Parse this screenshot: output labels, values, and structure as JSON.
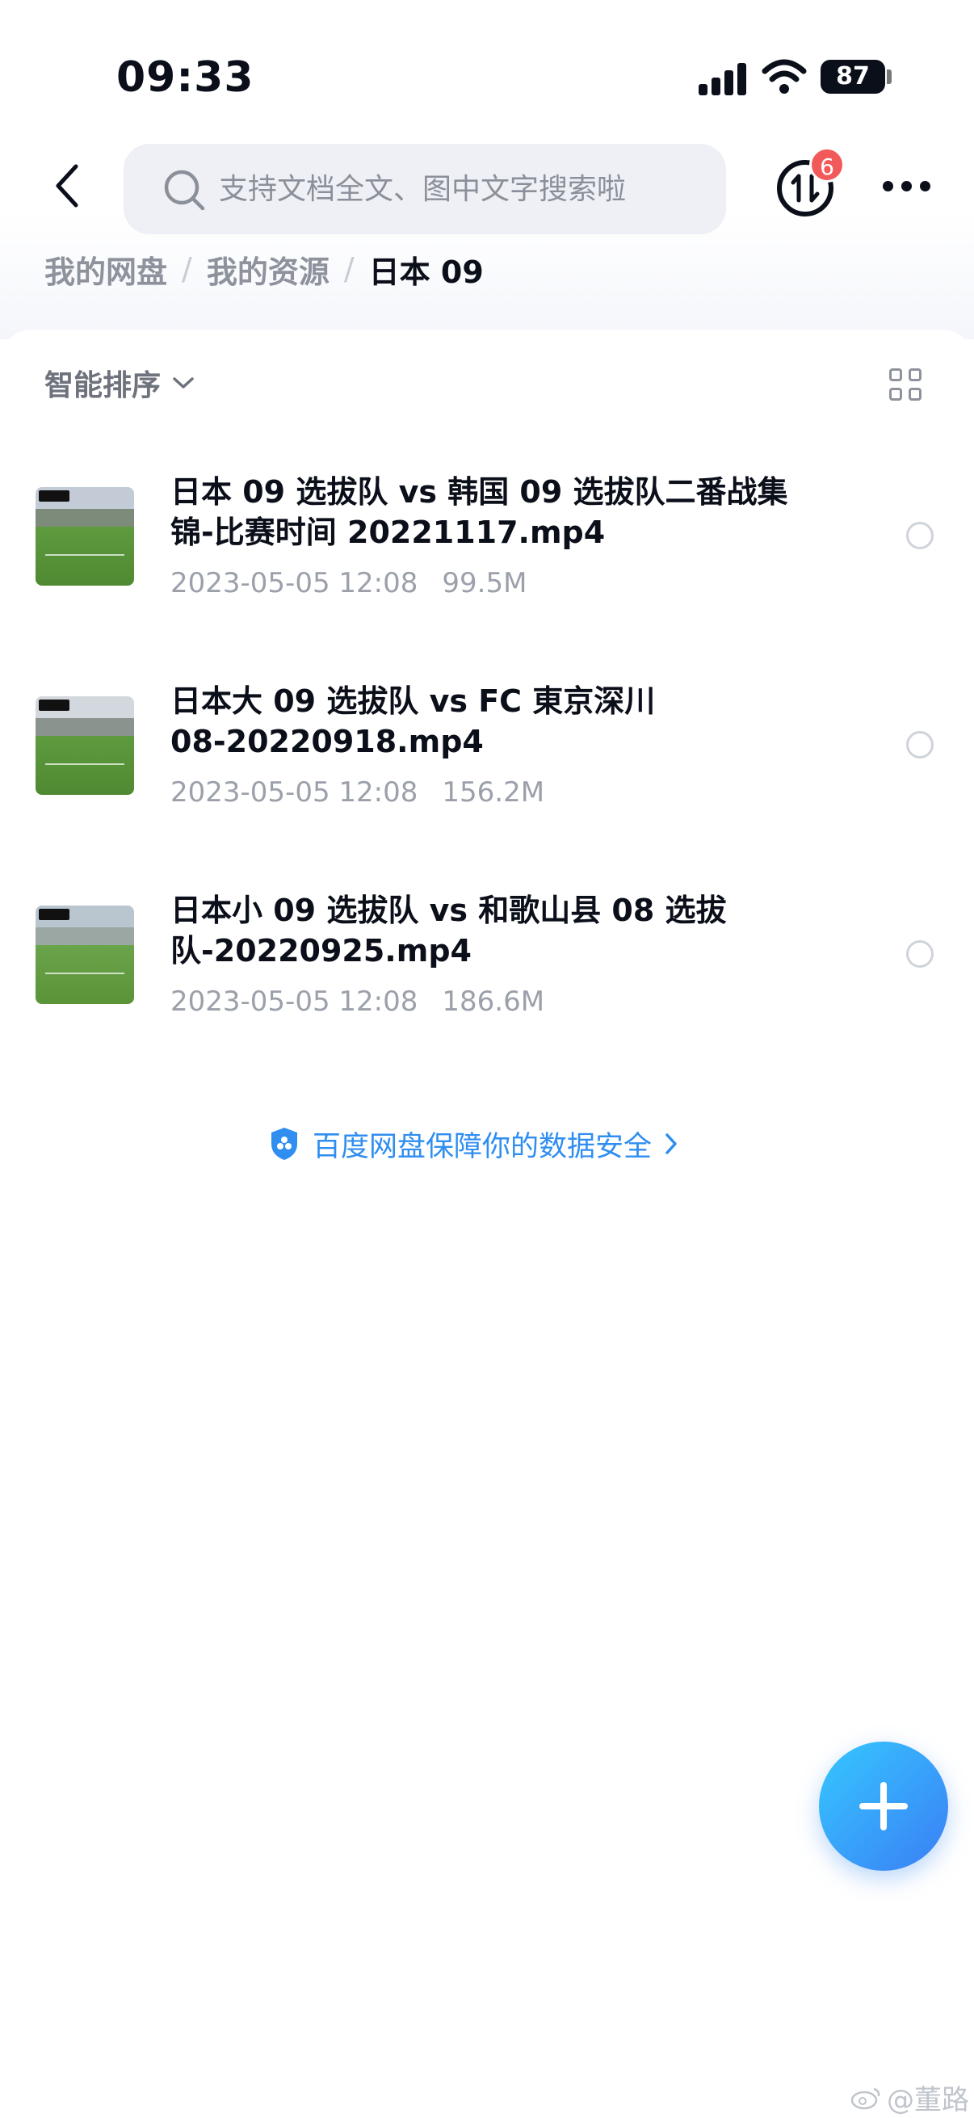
{
  "status_bar": {
    "time": "09:33",
    "battery": "87"
  },
  "nav": {
    "search_placeholder": "支持文档全文、图中文字搜索啦",
    "transfer_badge": "6"
  },
  "breadcrumb": {
    "root": "我的网盘",
    "parent": "我的资源",
    "current": "日本 09"
  },
  "toolbar": {
    "sort_label": "智能排序"
  },
  "files": [
    {
      "name_line1": "日本 09 选拔队 vs 韩国 09 选拔队二番战集",
      "name_line2": "锦-比赛时间 20221117.mp4",
      "date": "2023-05-05 12:08",
      "size": "99.5M"
    },
    {
      "name_line1": "日本大 09 选拔队 vs FC 東京深川",
      "name_line2": "08-20220918.mp4",
      "date": "2023-05-05 12:08",
      "size": "156.2M"
    },
    {
      "name_line1": "日本小 09 选拔队 vs 和歌山县 08 选拔",
      "name_line2": "队-20220925.mp4",
      "date": "2023-05-05 12:08",
      "size": "186.6M"
    }
  ],
  "safety_link": "百度网盘保障你的数据安全",
  "watermark": "@董路",
  "colors": {
    "accent": "#2f8ef0",
    "badge": "#f25a5a",
    "fab_start": "#35c8ff",
    "fab_end": "#3b7ef5"
  }
}
